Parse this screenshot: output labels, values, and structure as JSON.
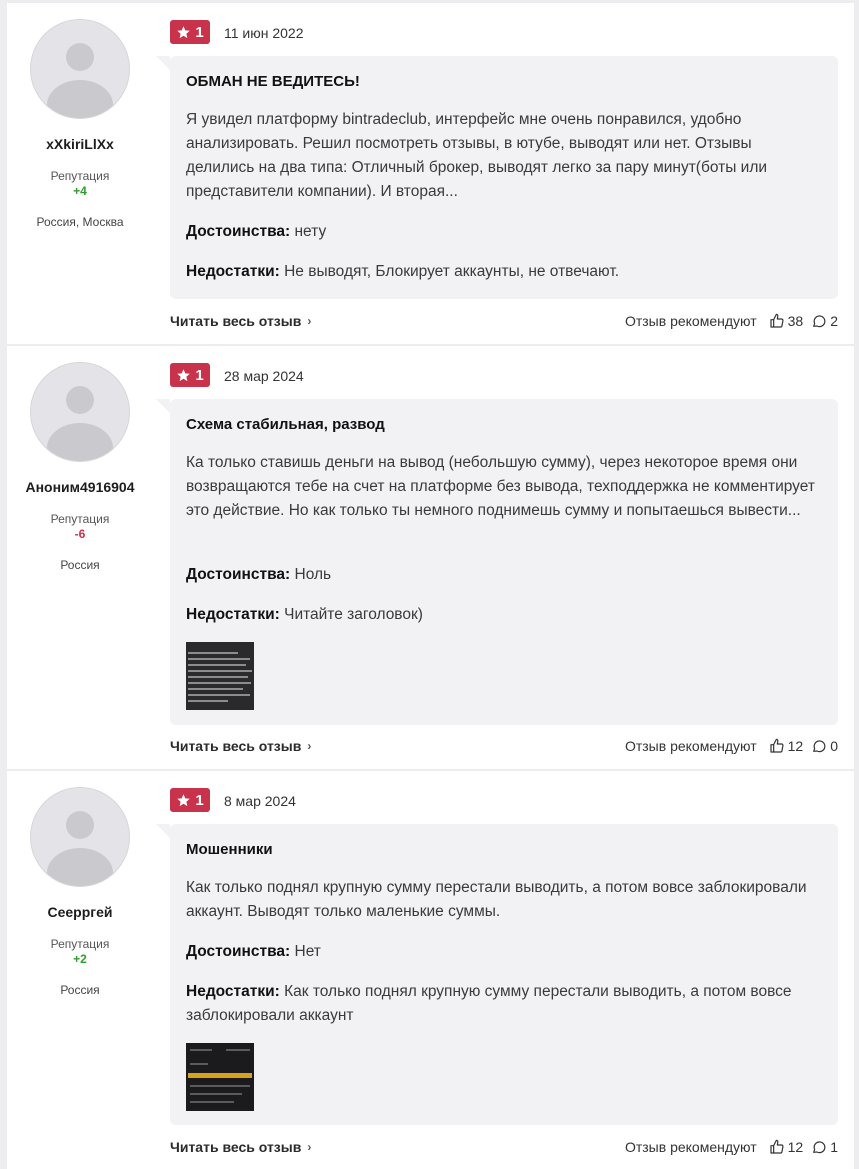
{
  "reviews": [
    {
      "author": "xXkiriLlXx",
      "reputation_label": "Репутация",
      "reputation": "+4",
      "reputation_sign": "pos",
      "location": "Россия, Москва",
      "rating": "1",
      "date": "11 июн 2022",
      "title": "ОБМАН НЕ ВЕДИТЕСЬ!",
      "text": "Я увидел платформу bintradeclub, интерфейс мне очень понравился, удобно анализировать. Решил посмотреть отзывы, в ютубе, выводят или нет. Отзывы делились на два типа: Отличный брокер, выводят легко за пару минут(боты или представители компании). И вторая...",
      "pros_label": "Достоинства:",
      "pros": "нету",
      "cons_label": "Недостатки:",
      "cons": "Не выводят, Блокирует аккаунты, не отвечают.",
      "read_more": "Читать весь отзыв",
      "recommend_label": "Отзыв рекомендуют",
      "likes": "38",
      "comments": "2"
    },
    {
      "author": "Аноним4916904",
      "reputation_label": "Репутация",
      "reputation": "-6",
      "reputation_sign": "neg",
      "location": "Россия",
      "rating": "1",
      "date": "28 мар 2024",
      "title": "Схема стабильная, развод",
      "text": "Ка только ставишь деньги на вывод (небольшую сумму), через некоторое время они возвращаются тебе на счет на платформе без вывода, техподдержка не комментирует это действие. Но как только ты немного поднимешь сумму и попытаешься вывести...",
      "pros_label": "Достоинства:",
      "pros": "Ноль",
      "cons_label": "Недостатки:",
      "cons": "Читайте заголовок)",
      "read_more": "Читать весь отзыв",
      "recommend_label": "Отзыв рекомендуют",
      "likes": "12",
      "comments": "0"
    },
    {
      "author": "Сеерргей",
      "reputation_label": "Репутация",
      "reputation": "+2",
      "reputation_sign": "pos",
      "location": "Россия",
      "rating": "1",
      "date": "8 мар 2024",
      "title": "Мошенники",
      "text": "Как только поднял крупную сумму перестали выводить, а потом вовсе заблокировали аккаунт. Выводят только маленькие суммы.",
      "pros_label": "Достоинства:",
      "pros": "Нет",
      "cons_label": "Недостатки:",
      "cons": "Как только поднял крупную сумму перестали выводить, а потом вовсе заблокировали аккаунт",
      "read_more": "Читать весь отзыв",
      "recommend_label": "Отзыв рекомендуют",
      "likes": "12",
      "comments": "1"
    }
  ],
  "icons": {
    "star": "star-icon",
    "like": "thumbs-up-icon",
    "comment": "comment-icon",
    "chevron": "chevron-right-icon"
  },
  "colors": {
    "rating_badge": "#c8324b",
    "reputation_positive": "#2e9e2e",
    "reputation_negative": "#c8324b",
    "bubble": "#f2f2f4"
  }
}
